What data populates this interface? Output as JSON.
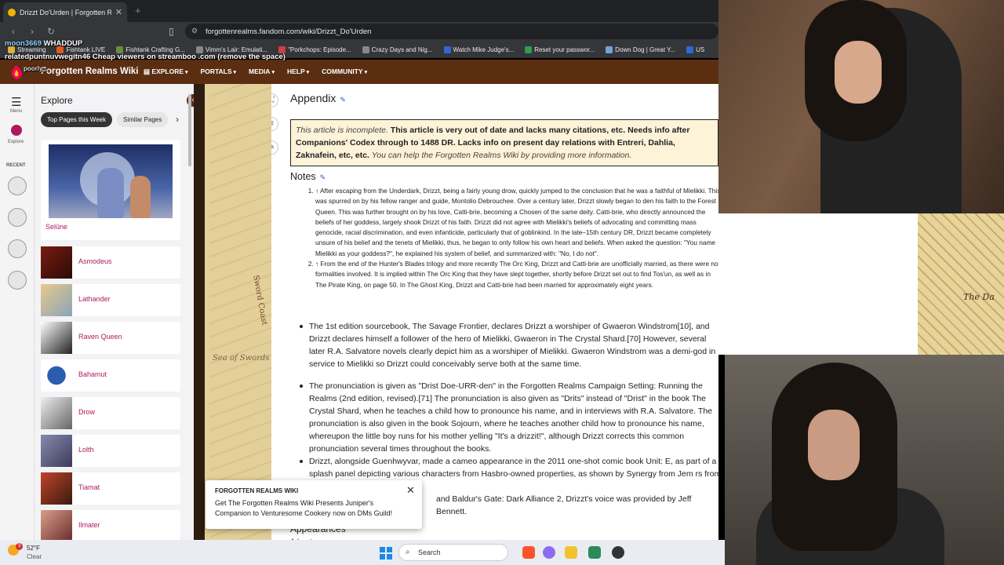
{
  "browser": {
    "tab_title": "Drizzt Do'Urden | Forgotten Realms",
    "url": "forgottenrealms.fandom.com/wiki/Drizzt_Do'Urden",
    "bookmarks": [
      "Streaming",
      "Fishtank LIVE",
      "Fishtank Crafting G...",
      "Vimm's Lair: Emulati...",
      "\"Porkchops: Episode...",
      "Crazy Days and Nig...",
      "Watch Mike Judge's...",
      "Reset your passwor...",
      "Down Dog | Great Y...",
      "US"
    ]
  },
  "chat_overlay": {
    "line1_user": "moon3669",
    "line1_text": "WHADDUP",
    "line2_user": "relatedpuntnuvwegitn46",
    "line2_text": "Cheap viewers on streamboo .com (remove the space)",
    "line3": "poorly..."
  },
  "fandom": {
    "wiki_name": "Forgotten Realms Wiki",
    "nav": [
      "EXPLORE",
      "PORTALS",
      "MEDIA",
      "HELP",
      "COMMUNITY"
    ]
  },
  "rail": {
    "menu_label": "Menu",
    "explore_label": "Explore",
    "recent_label": "RECENT"
  },
  "explore_panel": {
    "title": "Explore",
    "chips": [
      "Top Pages this Week",
      "Similar Pages"
    ],
    "featured_caption": "Selûne",
    "items": [
      "Asmodeus",
      "Lathander",
      "Raven Queen",
      "Bahamut",
      "Drow",
      "Lolth",
      "Tiamat",
      "Ilmater"
    ]
  },
  "map_labels": {
    "sword_coast": "Sword Coast",
    "sea": "Sea of Swords",
    "minimap": "The Da"
  },
  "article": {
    "appendix_heading": "Appendix",
    "notice_italic_lead": "This article is incomplete.",
    "notice_bold": "This article is very out of date and lacks many citations, etc. Needs info after Companions' Codex through to 1488 DR. Lacks info on present day relations with Entreri, Dahlia, Zaknafein, etc, etc.",
    "notice_italic_tail": "You can help the Forgotten Realms Wiki by providing more information.",
    "notes_heading": "Notes",
    "note1": "↑ After escaping from the Underdark, Drizzt, being a fairly young drow, quickly jumped to the conclusion that he was a faithful of Mielikki. This was spurred on by his fellow ranger and guide, Montolio Debrouchee. Over a century later, Drizzt slowly began to den his faith to the Forest Queen. This was further brought on by his love, Catti-brie, becoming a Chosen of the same deity. Catti-brie, who directly announced the beliefs of her goddess, largely shook Drizzt of his faith. Drizzt did not agree with Mielikki's beliefs of advocating and committing mass genocide, racial discrimination, and even infanticide, particularly that of goblinkind. In the late–15th century DR, Drizzt became completely unsure of his belief and the tenets of Mielikki, thus, he began to only follow his own heart and beliefs. When asked the question: \"You name Mielikki as your goddess?\", he explained his system of belief, and summarized with: \"No, I do not\".",
    "note2": "↑ From the end of the Hunter's Blades trilogy and more recently The Orc King, Drizzt and Catti-brie are unofficially married, as there were no formalities involved. It is implied within The Orc King that they have slept together, shortly before Drizzt set out to find Tos'un, as well as in The Pirate King, on page 50. In The Ghost King, Drizzt and Catti-brie had been married for approximately eight years.",
    "bullet1": "The 1st edition sourcebook, The Savage Frontier, declares Drizzt a worshiper of Gwaeron Windstrom[10], and Drizzt declares himself a follower of the hero of Mielikki, Gwaeron in The Crystal Shard.[70] However, several later R.A. Salvatore novels clearly depict him as a worshiper of Mielikki. Gwaeron Windstrom was a demi-god in service to Mielikki so Drizzt could conceivably serve both at the same time.",
    "bullet2": "The pronunciation is given as \"Drist Doe-URR-den\" in the Forgotten Realms Campaign Setting: Running the Realms (2nd edition, revised).[71] The pronunciation is also given as \"Drits\" instead of \"Drist\" in the book The Crystal Shard, when he teaches a child how to pronounce his name, and in interviews with R.A. Salvatore. The pronunciation is also given in the book Sojourn, where he teaches another child how to pronounce his name, whereupon the little boy runs for his mother yelling \"It's a drizzit!\", although Drizzt corrects this common pronunciation several times throughout the books.",
    "bullet3": "Drizzt, alongside Guenhwyvar, made a cameo appearance in the 2011 one-shot comic book Unit: E, as part of a splash panel depicting various characters from Hasbro-owned properties, as shown by Synergy from Jem rs from Micronauts).",
    "bullet4_fragment": "and Baldur's Gate: Dark Alliance 2, Drizzt's voice was provided by Jeff Bennett.",
    "appearances_heading": "Appearances",
    "adventures_heading": "Adventures"
  },
  "popup": {
    "title": "FORGOTTEN REALMS WIKI",
    "body": "Get The Forgotten Realms Wiki Presents Juniper's Companion to Venturesome Cookery now on DMs Guild!"
  },
  "taskbar": {
    "temp": "52°F",
    "condition": "Clear",
    "badge": "3",
    "search_placeholder": "Search"
  },
  "colors": {
    "fandom_nav": "#5b2e12",
    "link": "#2a5db0",
    "explore_link": "#b0185c",
    "notice_bg": "#fdf3d9"
  }
}
